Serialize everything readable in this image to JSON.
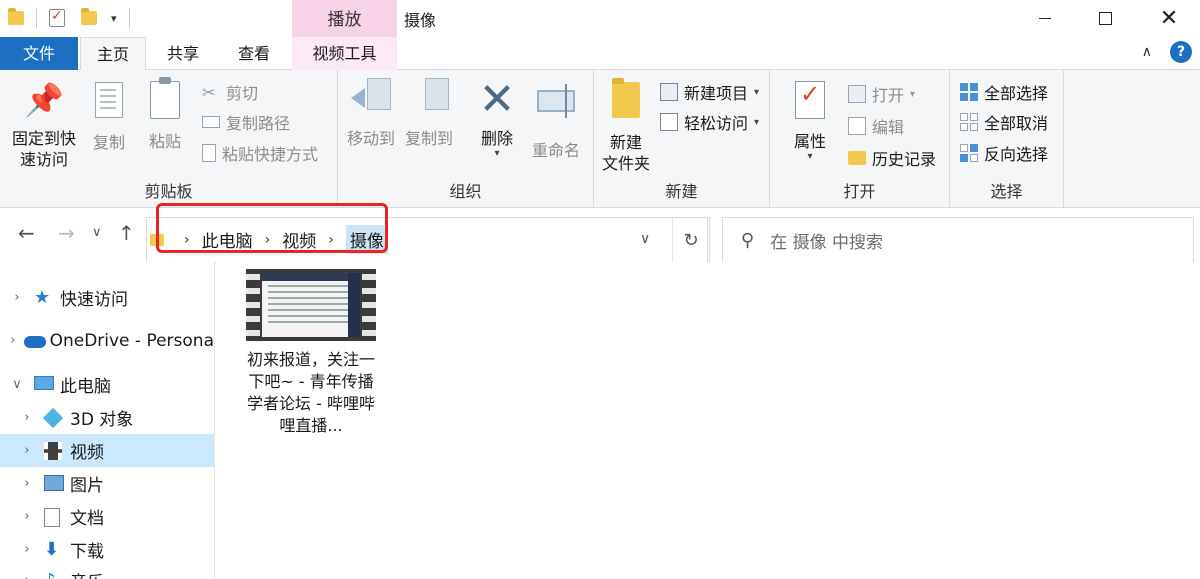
{
  "window": {
    "title": "摄像",
    "context_tab_header": "播放"
  },
  "tabs": {
    "file": "文件",
    "home": "主页",
    "share": "共享",
    "view": "查看",
    "video_tools": "视频工具"
  },
  "ribbon": {
    "clipboard": {
      "label": "剪贴板",
      "pin": "固定到快\n速访问",
      "pin_line1": "固定到快",
      "pin_line2": "速访问",
      "copy": "复制",
      "paste": "粘贴",
      "cut": "剪切",
      "copy_path": "复制路径",
      "paste_shortcut": "粘贴快捷方式"
    },
    "organize": {
      "label": "组织",
      "move_to": "移动到",
      "copy_to": "复制到",
      "delete": "删除",
      "rename": "重命名"
    },
    "new": {
      "label": "新建",
      "new_folder_line1": "新建",
      "new_folder_line2": "文件夹",
      "new_item": "新建项目",
      "easy_access": "轻松访问"
    },
    "open": {
      "label": "打开",
      "properties": "属性",
      "open": "打开",
      "edit": "编辑",
      "history": "历史记录"
    },
    "select": {
      "label": "选择",
      "select_all": "全部选择",
      "select_none": "全部取消",
      "invert": "反向选择"
    }
  },
  "address": {
    "crumbs": [
      "此电脑",
      "视频",
      "摄像"
    ],
    "search_placeholder": "在 摄像 中搜索"
  },
  "sidebar": {
    "items": [
      {
        "label": "快速访问",
        "icon": "star-icon"
      },
      {
        "label": "OneDrive - Persona",
        "icon": "cloud-icon"
      },
      {
        "label": "此电脑",
        "icon": "computer-icon"
      },
      {
        "label": "3D 对象",
        "icon": "cube-icon"
      },
      {
        "label": "视频",
        "icon": "video-folder-icon"
      },
      {
        "label": "图片",
        "icon": "pictures-icon"
      },
      {
        "label": "文档",
        "icon": "documents-icon"
      },
      {
        "label": "下载",
        "icon": "download-icon"
      },
      {
        "label": "音乐",
        "icon": "music-icon"
      }
    ]
  },
  "files": [
    {
      "name": "初来报道，关注一下吧~ - 青年传播学者论坛 - 哔哩哔哩直播..."
    }
  ],
  "colors": {
    "file_tab": "#1c6fc1",
    "selected_nav": "#cce8ff",
    "context_tab": "#f6d3e7",
    "highlight_box": "#e82424"
  }
}
